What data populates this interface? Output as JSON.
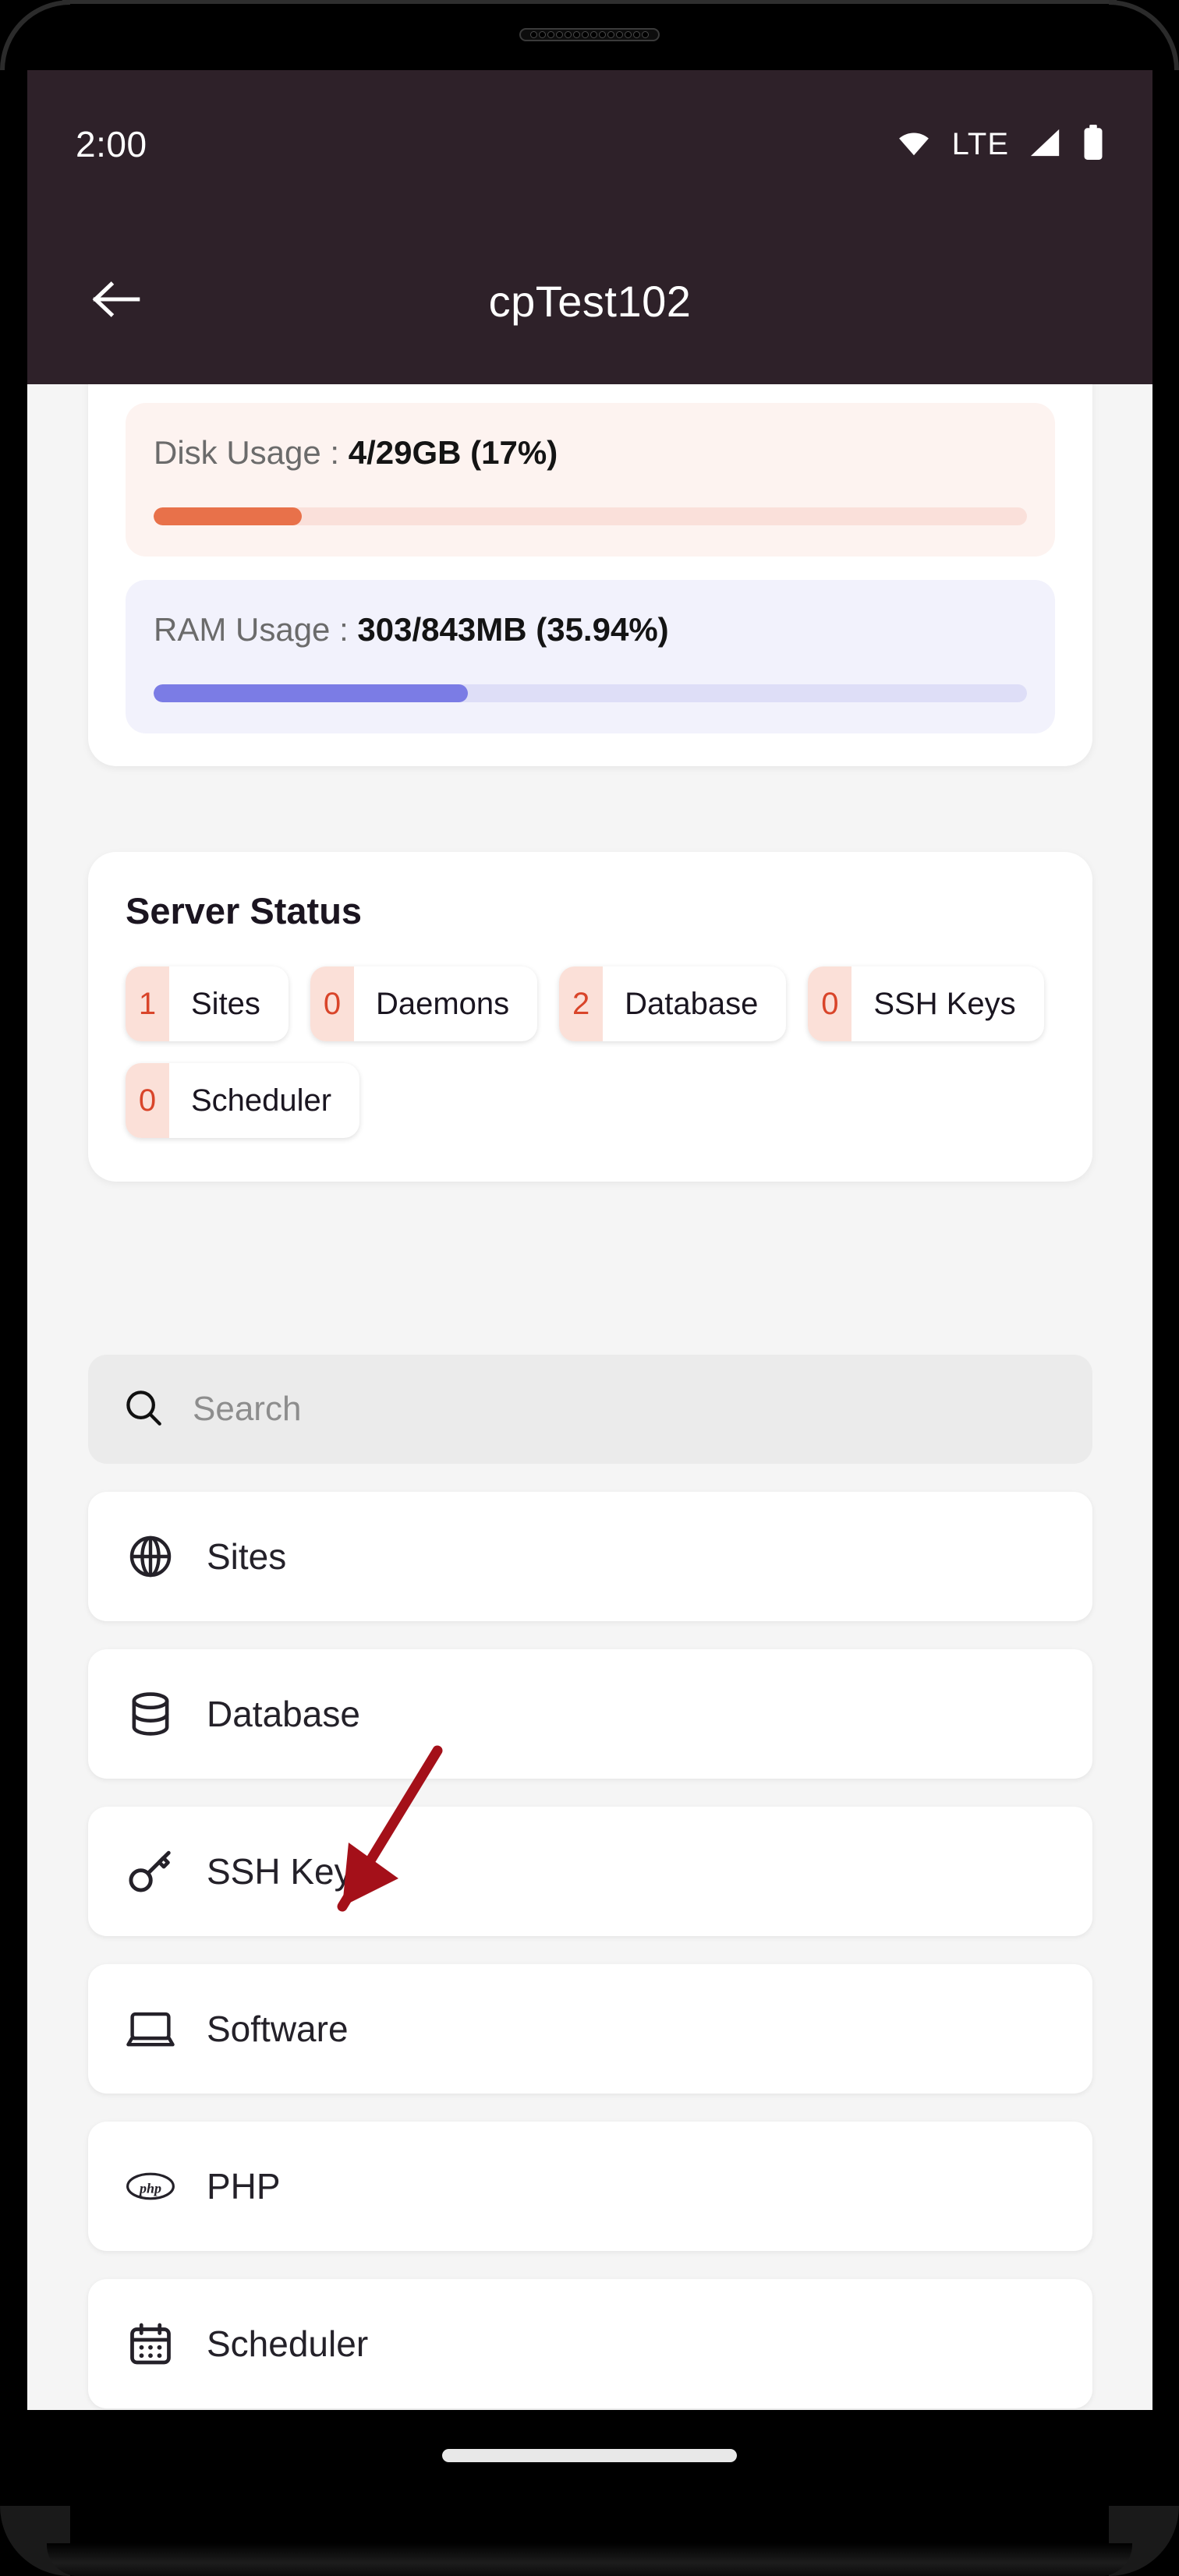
{
  "status_bar": {
    "time": "2:00",
    "network_label": "LTE",
    "icons": [
      "wifi-icon",
      "signal-icon",
      "battery-icon"
    ]
  },
  "app_bar": {
    "title": "cpTest102",
    "back_icon": "arrow-left-icon"
  },
  "usage": {
    "disk": {
      "label": "Disk Usage : ",
      "value": "4/29GB (17%)",
      "used": 4,
      "total": 29,
      "unit": "GB",
      "percent": 17,
      "bar_color": "#e8714a",
      "track_color": "#fae0da",
      "card_color": "#fdf3f0"
    },
    "ram": {
      "label": "RAM Usage : ",
      "value": "303/843MB (35.94%)",
      "used": 303,
      "total": 843,
      "unit": "MB",
      "percent": 35.94,
      "bar_color": "#7b7ce5",
      "track_color": "#dedef7",
      "card_color": "#f2f2fc"
    }
  },
  "server_status": {
    "title": "Server Status",
    "accent_count_color": "#d9452a",
    "accent_chip_bg": "#fbe0d8",
    "chips": [
      {
        "count": "1",
        "label": "Sites"
      },
      {
        "count": "0",
        "label": "Daemons"
      },
      {
        "count": "2",
        "label": "Database"
      },
      {
        "count": "0",
        "label": "SSH Keys"
      },
      {
        "count": "0",
        "label": "Scheduler"
      }
    ]
  },
  "search": {
    "placeholder": "Search",
    "value": "",
    "icon": "search-icon"
  },
  "menu": {
    "items": [
      {
        "label": "Sites",
        "icon": "globe-icon"
      },
      {
        "label": "Database",
        "icon": "database-icon"
      },
      {
        "label": "SSH Keys",
        "icon": "key-icon"
      },
      {
        "label": "Software",
        "icon": "laptop-icon"
      },
      {
        "label": "PHP",
        "icon": "php-icon"
      },
      {
        "label": "Scheduler",
        "icon": "calendar-icon"
      }
    ]
  },
  "annotation": {
    "type": "arrow",
    "color": "#a41019",
    "points_to": "Sites"
  }
}
